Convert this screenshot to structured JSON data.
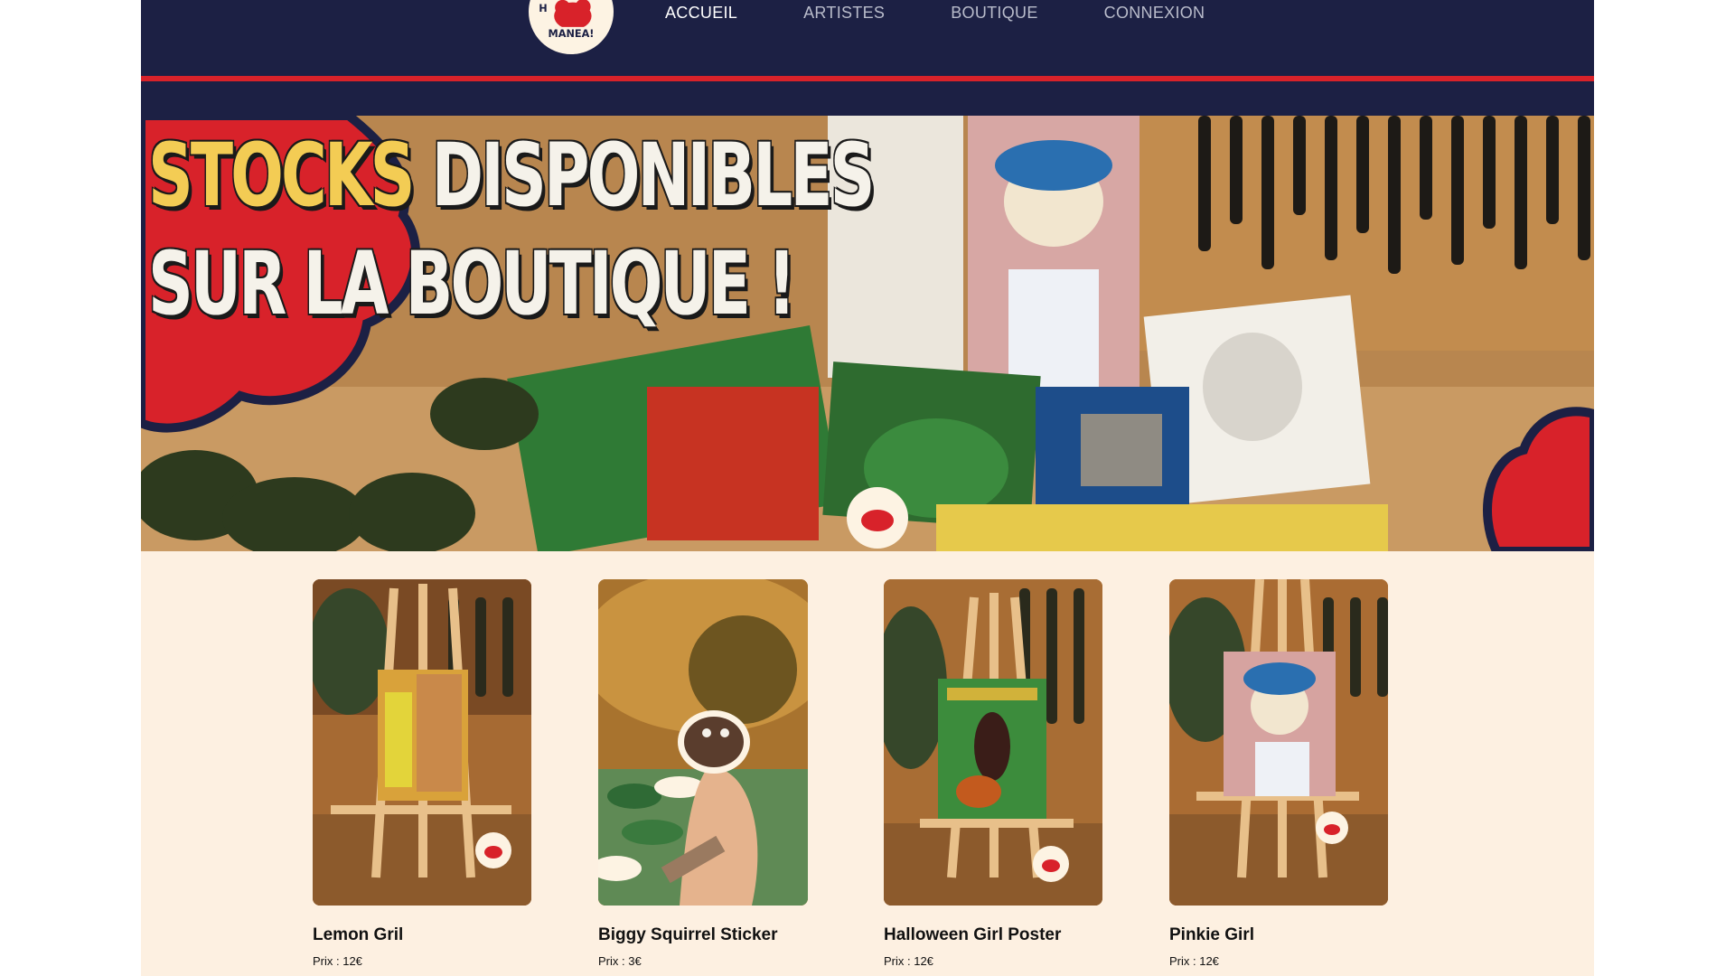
{
  "nav": {
    "logo_text_top": "HORA",
    "logo_text_bottom": "MANEA!",
    "links": [
      {
        "label": "ACCUEIL",
        "active": true
      },
      {
        "label": "ARTISTES",
        "active": false
      },
      {
        "label": "BOUTIQUE",
        "active": false
      },
      {
        "label": "CONNEXION",
        "active": false
      }
    ]
  },
  "hero": {
    "line1_highlight": "STOCKS",
    "line1_rest": "DISPONIBLES",
    "line2": "SUR LA BOUTIQUE !"
  },
  "products": [
    {
      "name": "Lemon Gril",
      "price": "Prix : 12€"
    },
    {
      "name": "Biggy Squirrel Sticker",
      "price": "Prix : 3€"
    },
    {
      "name": "Halloween Girl Poster",
      "price": "Prix : 12€"
    },
    {
      "name": "Pinkie Girl",
      "price": "Prix : 12€"
    }
  ],
  "colors": {
    "navy": "#1c2044",
    "red": "#d8222a",
    "cream": "#fdf0e1",
    "yellow": "#f3cc54"
  }
}
